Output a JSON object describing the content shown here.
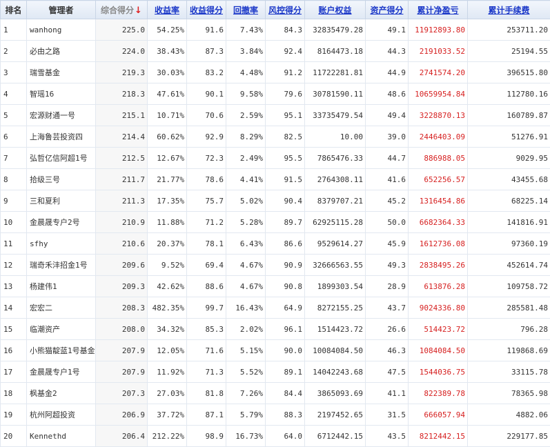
{
  "header": {
    "rank": "排名",
    "manager": "管理者",
    "composite": "综合得分",
    "composite_arrow": "↓",
    "return_rate": "收益率",
    "return_score": "收益得分",
    "drawdown": "回撤率",
    "risk_score": "风控得分",
    "equity": "账户权益",
    "asset_score": "资产得分",
    "cum_pnl": "累计净盈亏",
    "cum_fee": "累计手续费"
  },
  "rows": [
    [
      "1",
      "wanhong",
      "225.0",
      "54.25%",
      "91.6",
      "7.43%",
      "84.3",
      "32835479.28",
      "49.1",
      "11912893.80",
      "253711.20"
    ],
    [
      "2",
      "必由之路",
      "224.0",
      "38.43%",
      "87.3",
      "3.84%",
      "92.4",
      "8164473.18",
      "44.3",
      "2191033.52",
      "25194.55"
    ],
    [
      "3",
      "瑞雪基金",
      "219.3",
      "30.03%",
      "83.2",
      "4.48%",
      "91.2",
      "11722281.81",
      "44.9",
      "2741574.20",
      "396515.80"
    ],
    [
      "4",
      "智瑶16",
      "218.3",
      "47.61%",
      "90.1",
      "9.58%",
      "79.6",
      "30781590.11",
      "48.6",
      "10659954.84",
      "112780.16"
    ],
    [
      "5",
      "宏源财通一号",
      "215.1",
      "10.71%",
      "70.6",
      "2.59%",
      "95.1",
      "33735479.54",
      "49.4",
      "3228870.13",
      "160789.87"
    ],
    [
      "6",
      "上海鲁芸投资四",
      "214.4",
      "60.62%",
      "92.9",
      "8.29%",
      "82.5",
      "10.00",
      "39.0",
      "2446403.09",
      "51276.91"
    ],
    [
      "7",
      "弘哲亿信阿超1号",
      "212.5",
      "12.67%",
      "72.3",
      "2.49%",
      "95.5",
      "7865476.33",
      "44.7",
      "886988.05",
      "9029.95"
    ],
    [
      "8",
      "拾级三号",
      "211.7",
      "21.77%",
      "78.6",
      "4.41%",
      "91.5",
      "2764308.11",
      "41.6",
      "652256.57",
      "43455.68"
    ],
    [
      "9",
      "三和夏利",
      "211.3",
      "17.35%",
      "75.7",
      "5.02%",
      "90.4",
      "8379707.21",
      "45.2",
      "1316454.86",
      "68225.14"
    ],
    [
      "10",
      "金晨晟专户2号",
      "210.9",
      "11.88%",
      "71.2",
      "5.28%",
      "89.7",
      "62925115.28",
      "50.0",
      "6682364.33",
      "141816.91"
    ],
    [
      "11",
      "sfhy",
      "210.6",
      "20.37%",
      "78.1",
      "6.43%",
      "86.6",
      "9529614.27",
      "45.9",
      "1612736.08",
      "97360.19"
    ],
    [
      "12",
      "瑞奇禾沣招金1号",
      "209.6",
      "9.52%",
      "69.4",
      "4.67%",
      "90.9",
      "32666563.55",
      "49.3",
      "2838495.26",
      "452614.74"
    ],
    [
      "13",
      "杨建伟1",
      "209.3",
      "42.62%",
      "88.6",
      "4.67%",
      "90.8",
      "1899303.54",
      "28.9",
      "613876.28",
      "109758.72"
    ],
    [
      "14",
      "宏宏二",
      "208.3",
      "482.35%",
      "99.7",
      "16.43%",
      "64.9",
      "8272155.25",
      "43.7",
      "9024336.80",
      "285581.48"
    ],
    [
      "15",
      "临潮资产",
      "208.0",
      "34.32%",
      "85.3",
      "2.02%",
      "96.1",
      "1514423.72",
      "26.6",
      "514423.72",
      "796.28"
    ],
    [
      "16",
      "小熊猫靛蓝1号基金",
      "207.9",
      "12.05%",
      "71.6",
      "5.15%",
      "90.0",
      "10084084.50",
      "46.3",
      "1084084.50",
      "119868.69"
    ],
    [
      "17",
      "金晨晟专户1号",
      "207.9",
      "11.92%",
      "71.3",
      "5.52%",
      "89.1",
      "14042243.68",
      "47.5",
      "1544036.75",
      "33115.78"
    ],
    [
      "18",
      "枫基金2",
      "207.3",
      "27.03%",
      "81.8",
      "7.26%",
      "84.4",
      "3865093.69",
      "41.1",
      "822389.78",
      "78365.98"
    ],
    [
      "19",
      "杭州阿超投资",
      "206.9",
      "37.72%",
      "87.1",
      "5.79%",
      "88.3",
      "2197452.65",
      "31.5",
      "666057.94",
      "4882.06"
    ],
    [
      "20",
      "Kennethd",
      "206.4",
      "212.22%",
      "98.9",
      "16.73%",
      "64.0",
      "6712442.15",
      "43.5",
      "8212442.15",
      "229177.85"
    ]
  ],
  "colors": {
    "pnl": "#d62020",
    "link": "#1a37c8",
    "sort_arrow": "#e02020"
  }
}
